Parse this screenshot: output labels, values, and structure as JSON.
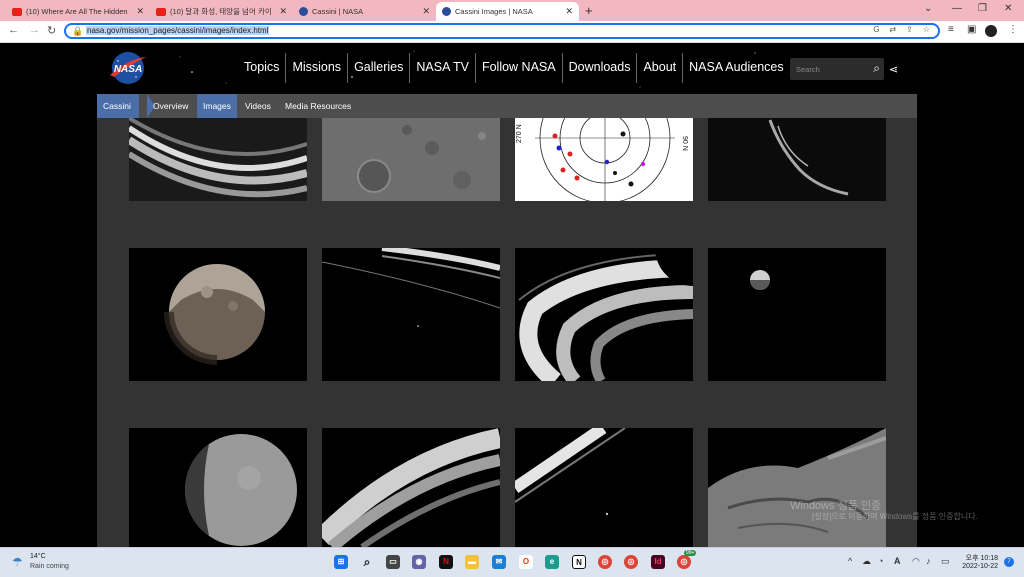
{
  "browser": {
    "tabs": [
      {
        "title": "(10) Where Are All The Hidden",
        "icon": "youtube-icon"
      },
      {
        "title": "(10) 달과 화성, 태양을 넘어 카이",
        "icon": "youtube-icon"
      },
      {
        "title": "Cassini | NASA",
        "icon": "nasa-icon"
      },
      {
        "title": "Cassini Images | NASA",
        "icon": "nasa-icon"
      }
    ],
    "url": "nasa.gov/mission_pages/cassini/images/index.html"
  },
  "header": {
    "logo_text": "NASA",
    "nav": [
      "Topics",
      "Missions",
      "Galleries",
      "NASA TV",
      "Follow NASA",
      "Downloads",
      "About",
      "NASA Audiences"
    ],
    "search_placeholder": "Search"
  },
  "subnav": {
    "home": "Cassini",
    "items": [
      "Overview",
      "Images",
      "Videos",
      "Media Resources"
    ],
    "active": "Images"
  },
  "gallery": {
    "chart_labels": {
      "left": "270 N",
      "right": "90 N"
    }
  },
  "watermark": {
    "line1": "Windows 정품 인증",
    "line2": "[설정]으로 이동하여 Windows를 정품 인증합니다."
  },
  "taskbar": {
    "weather_temp": "14°C",
    "weather_desc": "Rain coming",
    "time": "오후 10:18",
    "date": "2022-10-22",
    "badge": "7",
    "chrome_badge": "99+"
  }
}
